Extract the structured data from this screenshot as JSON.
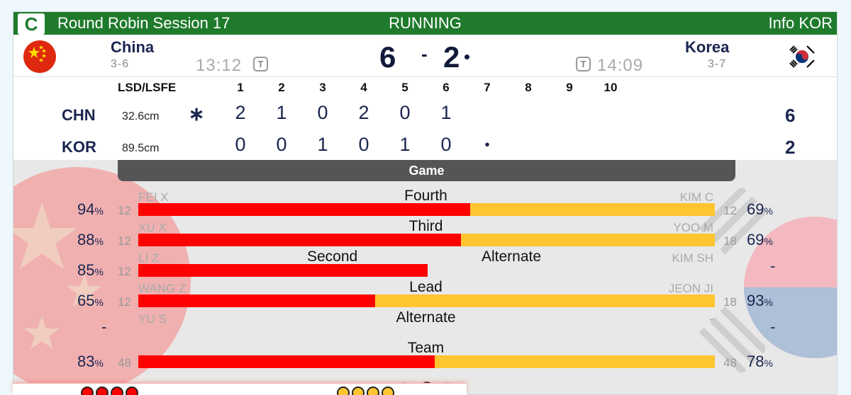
{
  "header": {
    "badge": "C",
    "session_title": "Round Robin Session 17",
    "status": "RUNNING",
    "info_link": "Info KOR",
    "accent_color": "#1f7a2c"
  },
  "teams": {
    "chn": {
      "name": "China",
      "record": "3-6",
      "clock": "13:12",
      "timeout_label": "T",
      "score": "6"
    },
    "kor": {
      "name": "Korea",
      "record": "3-7",
      "clock": "14:09",
      "timeout_label": "T",
      "score": "2"
    },
    "score_separator": "-"
  },
  "linescore": {
    "lsd_header": "LSD/LSFE",
    "end_headers": [
      "1",
      "2",
      "3",
      "4",
      "5",
      "6",
      "7",
      "8",
      "9",
      "10"
    ],
    "rows": [
      {
        "abbr": "CHN",
        "lsd": "32.6cm",
        "marker": "∗",
        "ends": [
          "2",
          "1",
          "0",
          "2",
          "0",
          "1"
        ],
        "total": "6"
      },
      {
        "abbr": "KOR",
        "lsd": "89.5cm",
        "marker": "",
        "ends": [
          "0",
          "0",
          "1",
          "0",
          "1",
          "0",
          "•"
        ],
        "total": "2"
      }
    ]
  },
  "game": {
    "tab_label": "Game",
    "rows": [
      {
        "position": "Fourth",
        "left_name": "FEI X",
        "left_pct": "94",
        "left_shots": "12",
        "right_name": "KIM C",
        "right_pct": "69",
        "right_shots": "12",
        "split": 0.576
      },
      {
        "position": "Third",
        "left_name": "XU X",
        "left_pct": "88",
        "left_shots": "12",
        "right_name": "YOO M",
        "right_pct": "69",
        "right_shots": "18",
        "split": 0.56
      },
      {
        "position": "Second",
        "position_right": "Alternate",
        "left_name": "LI Z",
        "left_pct": "85",
        "left_shots": "12",
        "right_name": "KIM SH",
        "right_pct": "-",
        "right_shots": "",
        "split": 0.502,
        "right_empty": true
      },
      {
        "position": "Lead",
        "left_name": "WANG Z",
        "left_pct": "65",
        "left_shots": "12",
        "right_name": "JEON JI",
        "right_pct": "93",
        "right_shots": "18",
        "split": 0.411
      },
      {
        "position": "Alternate",
        "left_name": "YU S",
        "left_pct": "-",
        "left_shots": "",
        "right_name": "-",
        "right_pct": "-",
        "right_shots": "",
        "nobar": true
      },
      {
        "position": "Team",
        "left_name": "",
        "left_pct": "83",
        "left_shots": "48",
        "right_name": "",
        "right_pct": "78",
        "right_shots": "48",
        "split": 0.514
      }
    ],
    "pct_unit": "%",
    "colors": {
      "chn": "#ff0000",
      "kor": "#ffc531"
    },
    "pager": {
      "count": 5,
      "active_index": 2
    }
  },
  "stones": {
    "chn_remaining": 4,
    "kor_remaining": 4
  }
}
